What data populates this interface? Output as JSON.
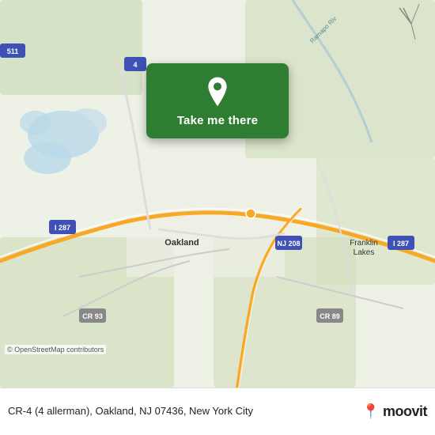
{
  "map": {
    "center_lat": 41.03,
    "center_lng": -74.24,
    "zoom": 12,
    "attribution": "© OpenStreetMap contributors"
  },
  "card": {
    "label": "Take me there",
    "pin_icon": "location-pin"
  },
  "bottom_bar": {
    "location_line1": "CR-4 (4 allerman), Oakland, NJ 07436, New York City",
    "moovit_label": "moovit",
    "moovit_pin_emoji": "📍"
  }
}
